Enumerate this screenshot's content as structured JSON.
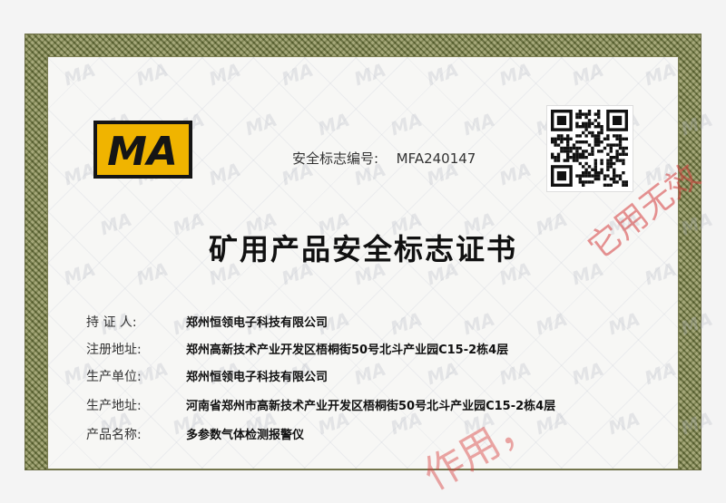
{
  "certificate": {
    "logo_text": "MA",
    "cert_no_label": "安全标志编号:",
    "cert_no_value": "MFA240147",
    "title": "矿用产品安全标志证书",
    "fields": [
      {
        "label": "持  证  人:",
        "value": "郑州恒领电子科技有限公司"
      },
      {
        "label": "注册地址:",
        "value": "郑州高新技术产业开发区梧桐街50号北斗产业园C15-2栋4层"
      },
      {
        "label": "生产单位:",
        "value": "郑州恒领电子科技有限公司"
      },
      {
        "label": "生产地址:",
        "value": "河南省郑州市高新技术产业开发区梧桐街50号北斗产业园C15-2栋4层"
      },
      {
        "label": "产品名称:",
        "value": "多参数气体检测报警仪"
      }
    ],
    "stamp_text_upper": "它用无效",
    "stamp_text_lower": "作用，"
  },
  "colors": {
    "frame": "#9ea078",
    "logo_bg": "#151515",
    "logo_fg": "#f0b400",
    "stamp": "#d63c3c"
  }
}
